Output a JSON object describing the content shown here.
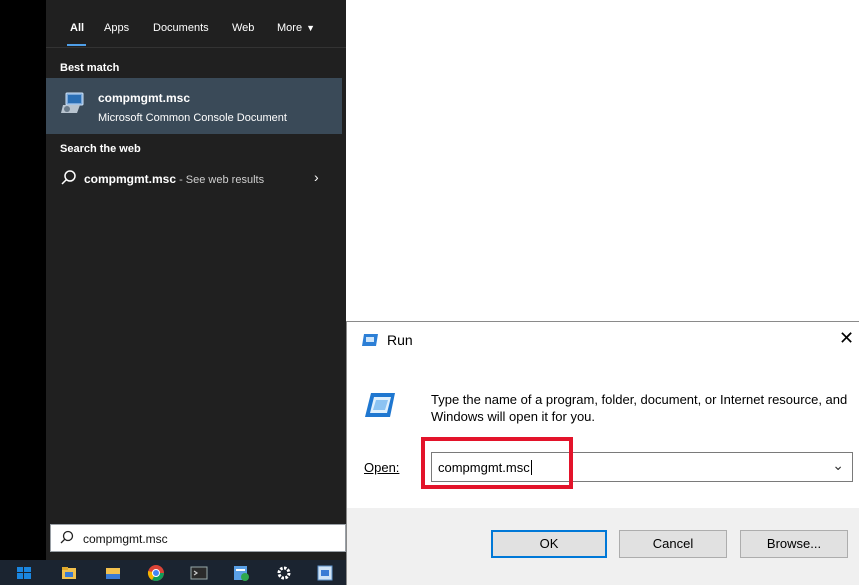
{
  "search_panel": {
    "tabs": [
      {
        "label": "All",
        "active": true
      },
      {
        "label": "Apps"
      },
      {
        "label": "Documents"
      },
      {
        "label": "Web"
      },
      {
        "label": "More"
      }
    ],
    "best_match_title": "Best match",
    "best_match": {
      "name": "compmgmt.msc",
      "type": "Microsoft Common Console Document",
      "icon": "computer-management-icon"
    },
    "search_web_title": "Search the web",
    "web_result": {
      "query": "compmgmt.msc",
      "suffix": " - See web results",
      "icon": "search-icon"
    },
    "search_box_value": "compmgmt.msc"
  },
  "taskbar": {
    "icons": [
      "windows-start-icon",
      "file-explorer-icon",
      "folder-icon",
      "chrome-icon",
      "terminal-icon",
      "app-icon",
      "settings-icon",
      "run-icon"
    ]
  },
  "run_dialog": {
    "title": "Run",
    "close": "✕",
    "description": "Type the name of a program, folder, document, or Internet resource, and Windows will open it for you.",
    "open_label": "Open:",
    "open_value": "compmgmt.msc",
    "ok_label": "OK",
    "cancel_label": "Cancel",
    "browse_label": "Browse...",
    "highlight_color": "#e3132a",
    "accent_color": "#0078d7"
  }
}
